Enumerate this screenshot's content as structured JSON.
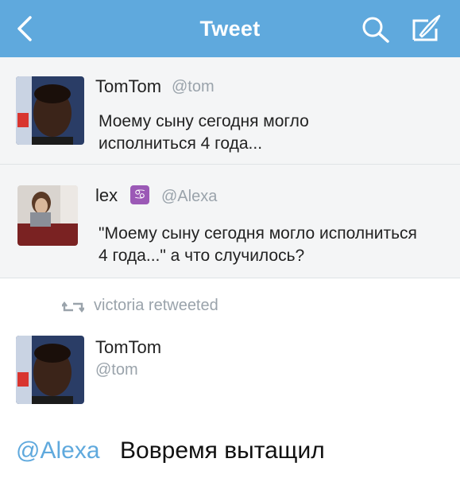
{
  "nav": {
    "title": "Tweet",
    "back_icon": "chevron-left-icon",
    "search_icon": "search-icon",
    "compose_icon": "compose-icon",
    "bar_color": "#5fa9dd"
  },
  "tweet1": {
    "name": "TomTom",
    "handle": "@tom",
    "line1": "Моему сыну сегодня могло",
    "line2": "исполниться 4 года..."
  },
  "tweet2": {
    "name": "lex",
    "zodiac": "♋",
    "handle": "@Alexa",
    "line1": "\"Моему сыну сегодня могло исполниться",
    "line2": "4 года...\" а что случилось?"
  },
  "retweet": {
    "icon": "retweet-icon",
    "label": "victoria retweeted"
  },
  "tweet3": {
    "name": "TomTom",
    "handle": "@tom",
    "mention": "@Alexa",
    "text": "Вовремя вытащил"
  }
}
